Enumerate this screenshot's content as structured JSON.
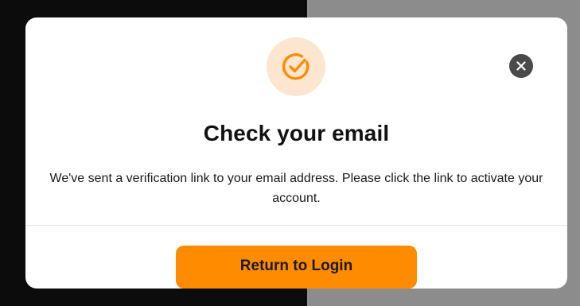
{
  "modal": {
    "title": "Check your email",
    "message": "We've sent a verification link to your email address. Please click the link to activate your account.",
    "status_icon": "check-circle-icon",
    "close_icon": "close-icon",
    "primary_button_label": "Return to Login"
  },
  "colors": {
    "accent": "#ff8c00",
    "icon_background": "#fde6d0",
    "close_button": "#4a4a4a",
    "backdrop_dark": "#0c0c0c",
    "backdrop_gray": "#8c8c8c"
  }
}
